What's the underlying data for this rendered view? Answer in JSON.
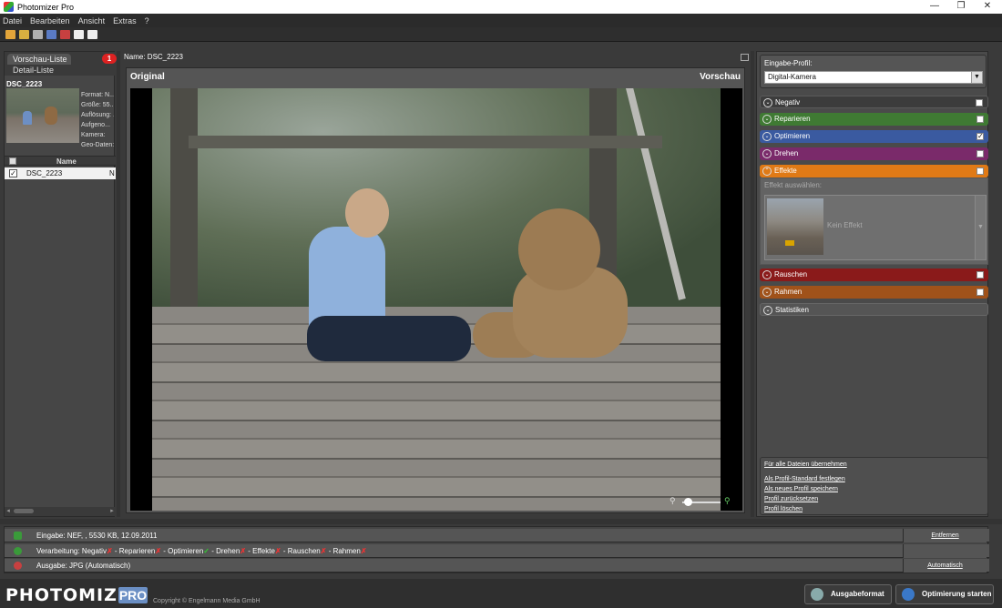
{
  "titlebar": {
    "title": "Photomizer Pro",
    "minimize": "—",
    "maximize": "❐",
    "close": "✕"
  },
  "menu": [
    "Datei",
    "Bearbeiten",
    "Ansicht",
    "Extras",
    "?"
  ],
  "left": {
    "tab_preview": "Vorschau-Liste",
    "tab_detail": "Detail-Liste",
    "badge": "1",
    "selected_name": "DSC_2223",
    "meta": [
      "Format: N...",
      "Größe: 55...",
      "Auflösung: ...",
      "Aufgeno...",
      "Kamera:",
      "Geo-Daten:"
    ],
    "list_header": "Name",
    "rows": [
      {
        "name": "DSC_2223",
        "col2": "N"
      }
    ]
  },
  "center": {
    "name_label": "Name: DSC_2223",
    "original": "Original",
    "preview": "Vorschau"
  },
  "right": {
    "profile_label": "Eingabe-Profil:",
    "profile_value": "Digital-Kamera",
    "sections": [
      {
        "label": "Negativ",
        "checked": false,
        "color": "#4a4a4a"
      },
      {
        "label": "Reparieren",
        "checked": false,
        "color": "#3f7a33"
      },
      {
        "label": "Optimieren",
        "checked": true,
        "color": "#3a5aa0"
      },
      {
        "label": "Drehen",
        "checked": false,
        "color": "#7a2a6a"
      },
      {
        "label": "Effekte",
        "checked": false,
        "color": "#e07a16"
      },
      {
        "label": "Rauschen",
        "checked": false,
        "color": "#8a1a1a"
      },
      {
        "label": "Rahmen",
        "checked": false,
        "color": "#a0521a"
      },
      {
        "label": "Statistiken",
        "checked": null,
        "color": "#555555"
      }
    ],
    "effect_select_label": "Effekt auswählen:",
    "effect_value": "Kein Effekt",
    "links": [
      "Für alle Dateien übernehmen",
      "Als Profil-Standard festlegen",
      "Als neues Profil speichern",
      "Profil zurücksetzen",
      "Profil löschen"
    ]
  },
  "status": {
    "input": "Eingabe: NEF, , 5530 KB, 12.09.2011",
    "input_action": "Entfernen",
    "processing_prefix": "Verarbeitung:",
    "processing_items": [
      {
        "label": "Negativ",
        "ok": false
      },
      {
        "label": "Reparieren",
        "ok": false
      },
      {
        "label": "Optimieren",
        "ok": true
      },
      {
        "label": "Drehen",
        "ok": false
      },
      {
        "label": "Effekte",
        "ok": false
      },
      {
        "label": "Rauschen",
        "ok": false
      },
      {
        "label": "Rahmen",
        "ok": false
      }
    ],
    "output": "Ausgabe: JPG (Automatisch)",
    "output_action": "Automatisch"
  },
  "footer": {
    "logo": "PHOTOMIZER",
    "logo_pro": "PRO",
    "copyright": "Copyright © Engelmann Media GmbH",
    "btn_format": "Ausgabeformat",
    "btn_start": "Optimierung starten"
  }
}
